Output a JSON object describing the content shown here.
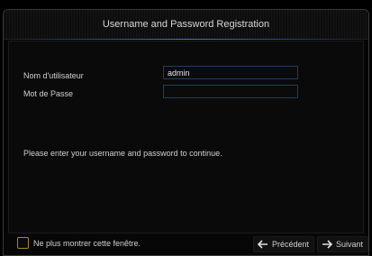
{
  "window": {
    "title": "Username and Password Registration"
  },
  "form": {
    "username_label": "Nom d'utilisateur",
    "username_value": "admin",
    "password_label": "Mot de Passe",
    "password_value": ""
  },
  "message": "Please enter your username and password to continue.",
  "footer": {
    "checkbox_label": "Ne plus montrer cette fenêtre.",
    "checkbox_checked": false,
    "prev_label": "Précédent",
    "next_label": "Suivant"
  },
  "icons": {
    "prev": "arrow-left-icon",
    "next": "arrow-right-icon"
  },
  "colors": {
    "accent_blue": "#1c3f63",
    "checkbox_border": "#a48a2a"
  }
}
